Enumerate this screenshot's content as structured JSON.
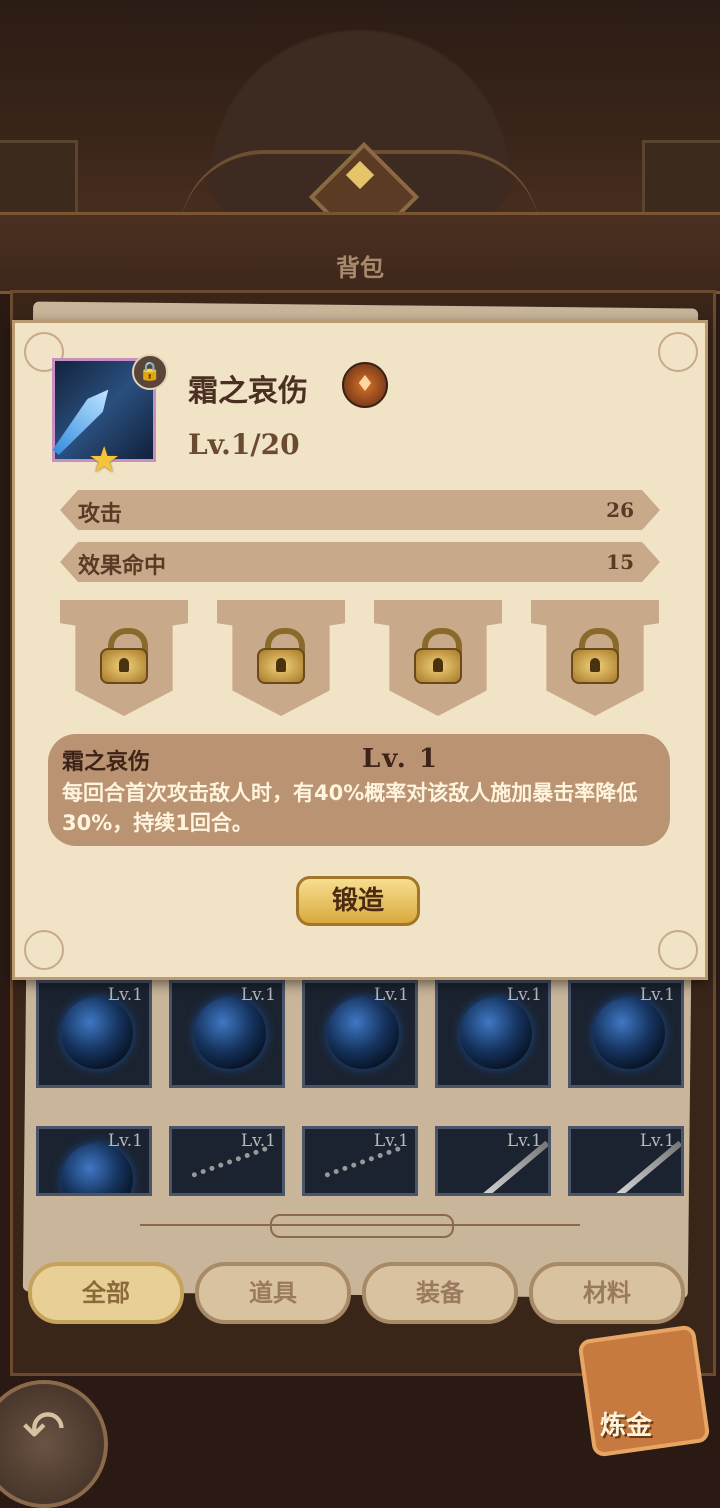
{
  "header": {
    "title": "背包"
  },
  "inventory": {
    "row1": [
      {
        "level": "Lv.1",
        "icon": "blue-orb-icon"
      },
      {
        "level": "Lv.1",
        "icon": "blue-orb-icon"
      },
      {
        "level": "Lv.1",
        "icon": "blue-orb-icon"
      },
      {
        "level": "Lv.1",
        "icon": "blue-orb-icon"
      },
      {
        "level": "Lv.1",
        "icon": "blue-orb-icon"
      }
    ],
    "row2": [
      {
        "level": "Lv.1",
        "icon": "blue-orb-icon"
      },
      {
        "level": "Lv.1",
        "icon": "chain-flail-icon"
      },
      {
        "level": "Lv.1",
        "icon": "chain-flail-icon"
      },
      {
        "level": "Lv.1",
        "icon": "sword-icon"
      },
      {
        "level": "Lv.1",
        "icon": "sword-icon"
      }
    ]
  },
  "tabs": [
    "全部",
    "道具",
    "装备",
    "材料"
  ],
  "active_tab": "全部",
  "alchemy_label": "炼金",
  "modal": {
    "item_name": "霜之哀伤",
    "level": "Lv.1/20",
    "stars": 1,
    "stats": [
      {
        "label": "攻击",
        "value": "26"
      },
      {
        "label": "效果命中",
        "value": "15"
      }
    ],
    "slots": [
      "locked",
      "locked",
      "locked",
      "locked"
    ],
    "skill": {
      "name": "霜之哀伤",
      "level": "Lv. 1",
      "description": "每回合首次攻击敌人时，有40%概率对该敌人施加暴击率降低30%，持续1回合。"
    },
    "forge_label": "锻造"
  }
}
